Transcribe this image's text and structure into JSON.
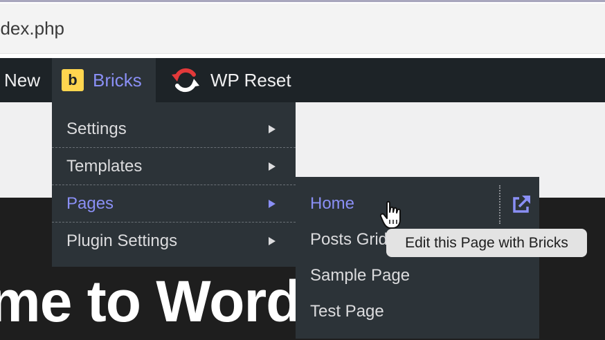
{
  "address_bar": {
    "url_text": "ndex.php"
  },
  "admin_bar": {
    "new_label": "New",
    "bricks": {
      "logo_letter": "b",
      "label": "Bricks",
      "logo_color": "#ffd64f",
      "label_color": "#8a8ff5"
    },
    "wp_reset": {
      "icon": "wp-reset-refresh-icon",
      "label": "WP Reset",
      "icon_color": "#e2393a"
    }
  },
  "bricks_menu": {
    "items": [
      {
        "label": "Settings",
        "has_submenu": true
      },
      {
        "label": "Templates",
        "has_submenu": true
      },
      {
        "label": "Pages",
        "has_submenu": true,
        "active": true
      },
      {
        "label": "Plugin Settings",
        "has_submenu": true
      }
    ]
  },
  "pages_submenu": {
    "items": [
      {
        "label": "Home",
        "active": true
      },
      {
        "label": "Posts Grid"
      },
      {
        "label": "Sample Page"
      },
      {
        "label": "Test Page"
      }
    ],
    "external_icon": "external-link-icon"
  },
  "tooltip": {
    "text": "Edit this Page with Bricks"
  },
  "page": {
    "hero_text": "me to Word"
  },
  "colors": {
    "admin_bar_bg": "#1d2327",
    "menu_bg": "#2c3338",
    "accent": "#8a8ff5"
  }
}
